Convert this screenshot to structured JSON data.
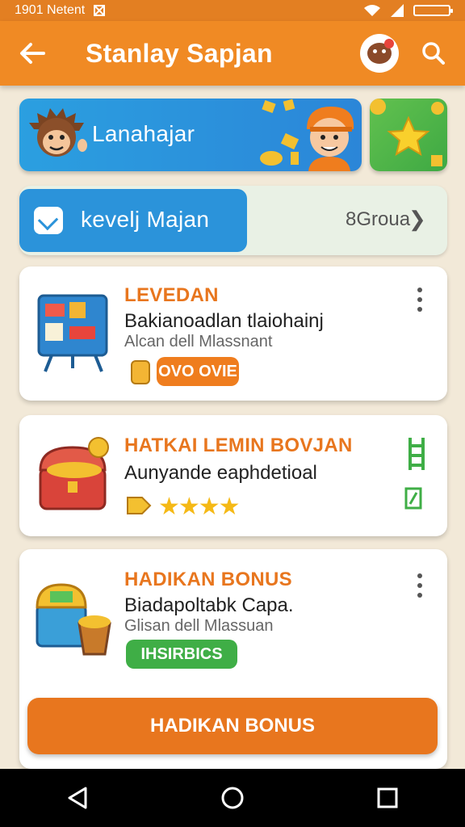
{
  "status": {
    "time": "1901 Netent",
    "icons": [
      "notification-icon",
      "wifi-icon",
      "signal-icon",
      "battery-icon"
    ]
  },
  "appbar": {
    "title": "Stanlay Sapjan",
    "icons": [
      "back-arrow-icon",
      "profile-avatar",
      "search-icon"
    ]
  },
  "banner": {
    "label": "Lanahajar"
  },
  "level": {
    "label": "kevelj Majan",
    "count": "8Groua"
  },
  "cards": [
    {
      "title": "LEVEDAN",
      "subtitle": "Bakianoadlan tlaiohainj",
      "meta": "Alcan dell Mlassnant",
      "pill": "OVO OVIE"
    },
    {
      "title": "HATKAI LEMIN BOVJAN",
      "subtitle": "Aunyande eaphdetioal",
      "rating": 4
    },
    {
      "title": "HADIKAN BONUS",
      "subtitle": "Biadapoltabk Capa.",
      "meta": "Glisan dell Mlassuan",
      "pill": "IHSIRBICS"
    }
  ],
  "button": {
    "label": "HADIKAN BONUS"
  },
  "colors": {
    "accent": "#f08a24",
    "orange_text": "#e8761e",
    "blue": "#2b93da",
    "green": "#3fae46"
  },
  "navbar": {
    "icons": [
      "back-triangle-icon",
      "home-circle-icon",
      "recents-square-icon"
    ]
  }
}
